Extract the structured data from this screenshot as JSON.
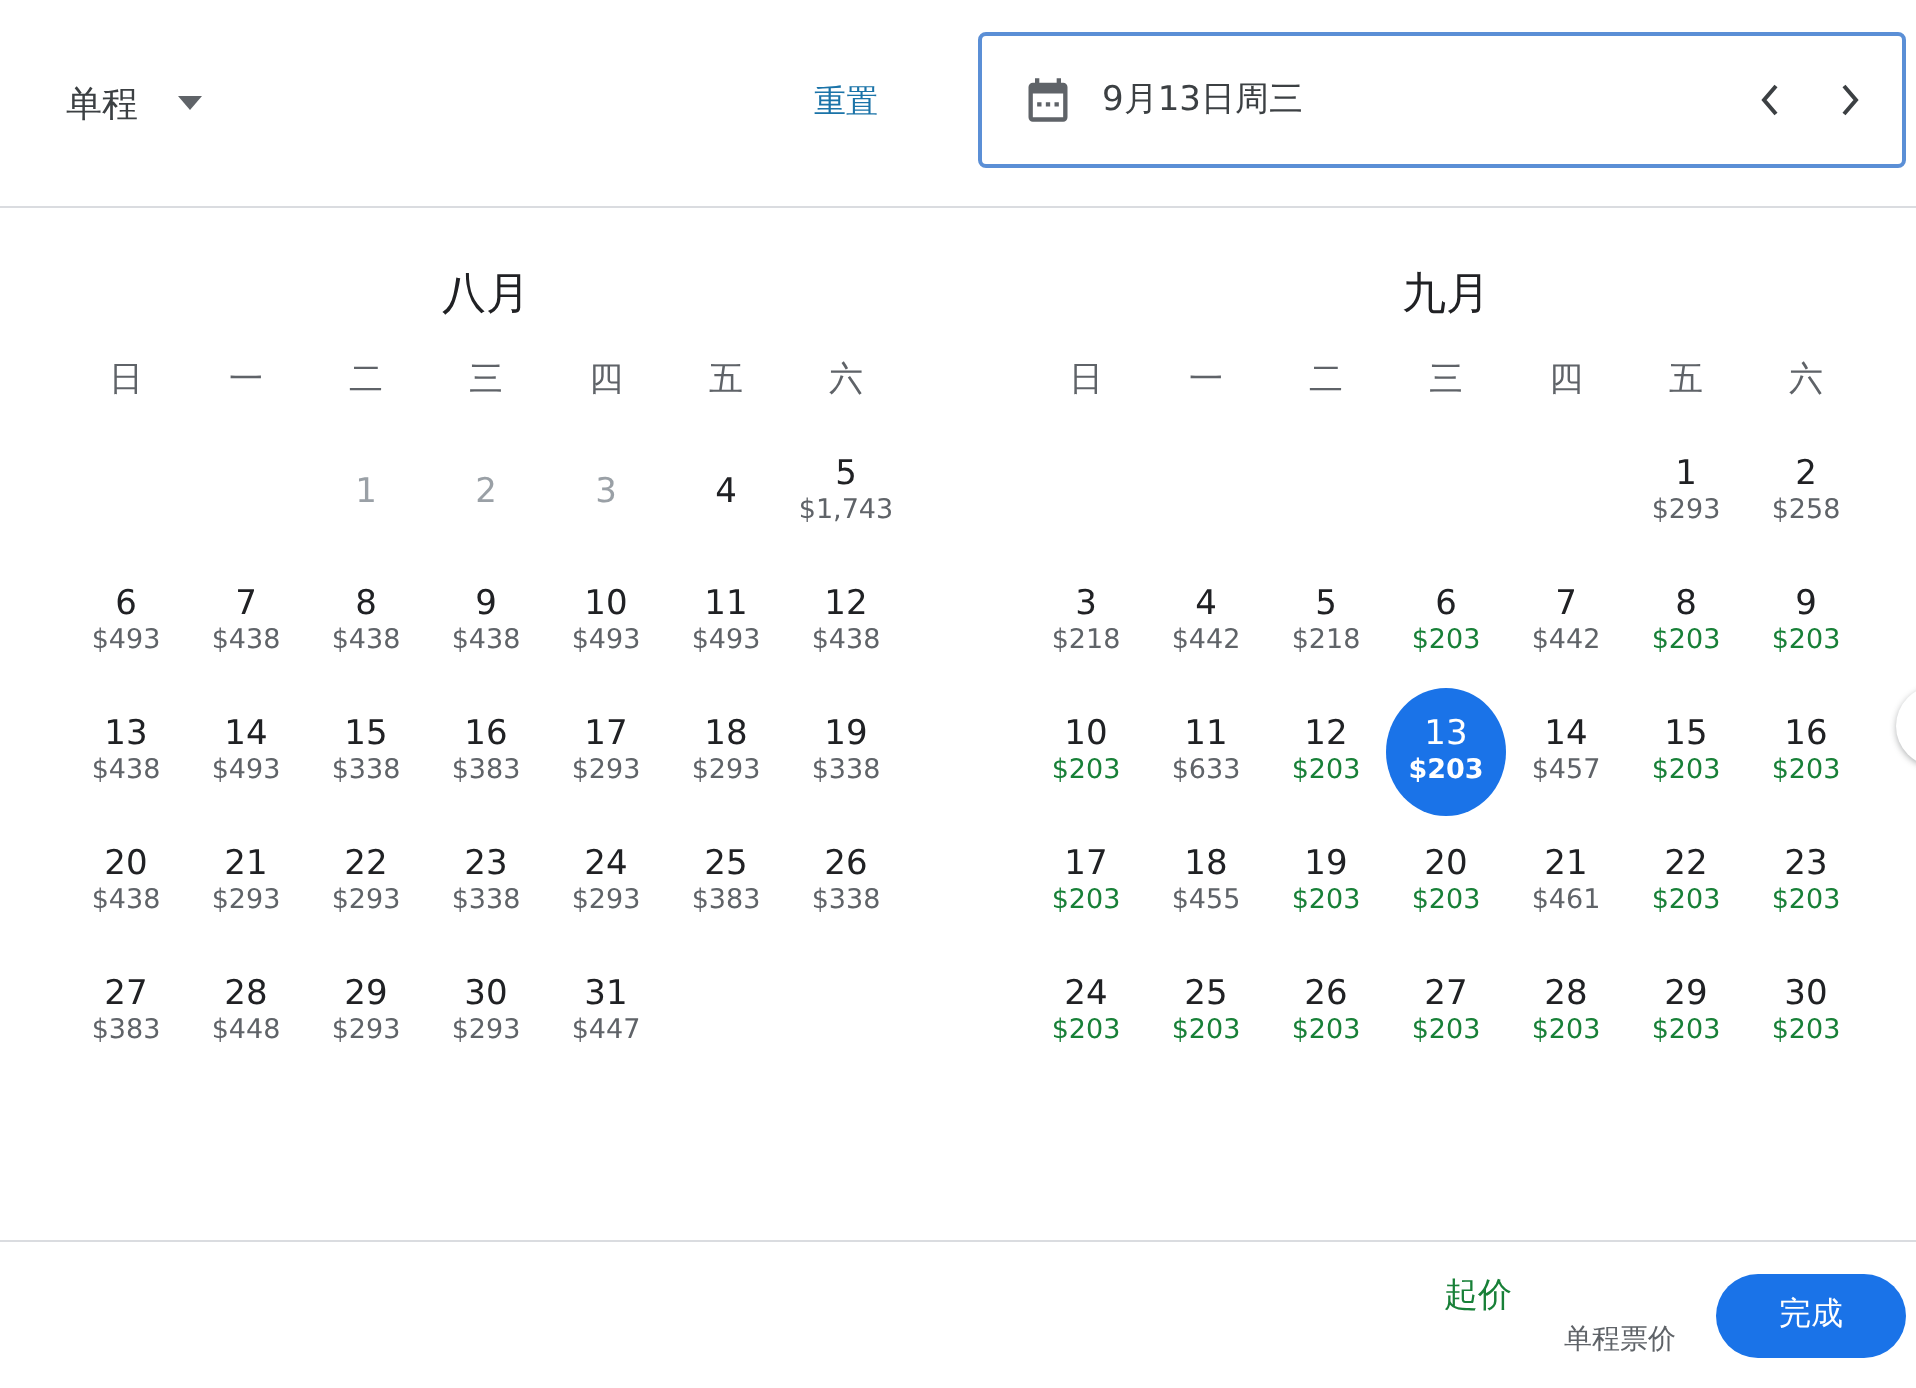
{
  "trip_type": {
    "label": "单程"
  },
  "reset_link": "重置",
  "date_field": {
    "value": "9月13日周三"
  },
  "months": [
    {
      "title": "八月",
      "weekdays": [
        "日",
        "一",
        "二",
        "三",
        "四",
        "五",
        "六"
      ],
      "days": [
        {
          "kind": "blank"
        },
        {
          "kind": "blank"
        },
        {
          "kind": "day",
          "number": "1",
          "disabled": true,
          "selected": false
        },
        {
          "kind": "day",
          "number": "2",
          "disabled": true,
          "selected": false
        },
        {
          "kind": "day",
          "number": "3",
          "disabled": true,
          "selected": false
        },
        {
          "kind": "day",
          "number": "4",
          "disabled": false,
          "selected": false
        },
        {
          "kind": "day",
          "number": "5",
          "price": "$1,743",
          "disabled": false,
          "low": false,
          "selected": false
        },
        {
          "kind": "day",
          "number": "6",
          "price": "$493",
          "disabled": false,
          "low": false,
          "selected": false
        },
        {
          "kind": "day",
          "number": "7",
          "price": "$438",
          "disabled": false,
          "low": false,
          "selected": false
        },
        {
          "kind": "day",
          "number": "8",
          "price": "$438",
          "disabled": false,
          "low": false,
          "selected": false
        },
        {
          "kind": "day",
          "number": "9",
          "price": "$438",
          "disabled": false,
          "low": false,
          "selected": false
        },
        {
          "kind": "day",
          "number": "10",
          "price": "$493",
          "disabled": false,
          "low": false,
          "selected": false
        },
        {
          "kind": "day",
          "number": "11",
          "price": "$493",
          "disabled": false,
          "low": false,
          "selected": false
        },
        {
          "kind": "day",
          "number": "12",
          "price": "$438",
          "disabled": false,
          "low": false,
          "selected": false
        },
        {
          "kind": "day",
          "number": "13",
          "price": "$438",
          "disabled": false,
          "low": false,
          "selected": false
        },
        {
          "kind": "day",
          "number": "14",
          "price": "$493",
          "disabled": false,
          "low": false,
          "selected": false
        },
        {
          "kind": "day",
          "number": "15",
          "price": "$338",
          "disabled": false,
          "low": false,
          "selected": false
        },
        {
          "kind": "day",
          "number": "16",
          "price": "$383",
          "disabled": false,
          "low": false,
          "selected": false
        },
        {
          "kind": "day",
          "number": "17",
          "price": "$293",
          "disabled": false,
          "low": false,
          "selected": false
        },
        {
          "kind": "day",
          "number": "18",
          "price": "$293",
          "disabled": false,
          "low": false,
          "selected": false
        },
        {
          "kind": "day",
          "number": "19",
          "price": "$338",
          "disabled": false,
          "low": false,
          "selected": false
        },
        {
          "kind": "day",
          "number": "20",
          "price": "$438",
          "disabled": false,
          "low": false,
          "selected": false
        },
        {
          "kind": "day",
          "number": "21",
          "price": "$293",
          "disabled": false,
          "low": false,
          "selected": false
        },
        {
          "kind": "day",
          "number": "22",
          "price": "$293",
          "disabled": false,
          "low": false,
          "selected": false
        },
        {
          "kind": "day",
          "number": "23",
          "price": "$338",
          "disabled": false,
          "low": false,
          "selected": false
        },
        {
          "kind": "day",
          "number": "24",
          "price": "$293",
          "disabled": false,
          "low": false,
          "selected": false
        },
        {
          "kind": "day",
          "number": "25",
          "price": "$383",
          "disabled": false,
          "low": false,
          "selected": false
        },
        {
          "kind": "day",
          "number": "26",
          "price": "$338",
          "disabled": false,
          "low": false,
          "selected": false
        },
        {
          "kind": "day",
          "number": "27",
          "price": "$383",
          "disabled": false,
          "low": false,
          "selected": false
        },
        {
          "kind": "day",
          "number": "28",
          "price": "$448",
          "disabled": false,
          "low": false,
          "selected": false
        },
        {
          "kind": "day",
          "number": "29",
          "price": "$293",
          "disabled": false,
          "low": false,
          "selected": false
        },
        {
          "kind": "day",
          "number": "30",
          "price": "$293",
          "disabled": false,
          "low": false,
          "selected": false
        },
        {
          "kind": "day",
          "number": "31",
          "price": "$447",
          "disabled": false,
          "low": false,
          "selected": false
        }
      ]
    },
    {
      "title": "九月",
      "weekdays": [
        "日",
        "一",
        "二",
        "三",
        "四",
        "五",
        "六"
      ],
      "days": [
        {
          "kind": "blank"
        },
        {
          "kind": "blank"
        },
        {
          "kind": "blank"
        },
        {
          "kind": "blank"
        },
        {
          "kind": "blank"
        },
        {
          "kind": "day",
          "number": "1",
          "price": "$293",
          "disabled": false,
          "low": false,
          "selected": false
        },
        {
          "kind": "day",
          "number": "2",
          "price": "$258",
          "disabled": false,
          "low": false,
          "selected": false
        },
        {
          "kind": "day",
          "number": "3",
          "price": "$218",
          "disabled": false,
          "low": false,
          "selected": false
        },
        {
          "kind": "day",
          "number": "4",
          "price": "$442",
          "disabled": false,
          "low": false,
          "selected": false
        },
        {
          "kind": "day",
          "number": "5",
          "price": "$218",
          "disabled": false,
          "low": false,
          "selected": false
        },
        {
          "kind": "day",
          "number": "6",
          "price": "$203",
          "disabled": false,
          "low": true,
          "selected": false
        },
        {
          "kind": "day",
          "number": "7",
          "price": "$442",
          "disabled": false,
          "low": false,
          "selected": false
        },
        {
          "kind": "day",
          "number": "8",
          "price": "$203",
          "disabled": false,
          "low": true,
          "selected": false
        },
        {
          "kind": "day",
          "number": "9",
          "price": "$203",
          "disabled": false,
          "low": true,
          "selected": false
        },
        {
          "kind": "day",
          "number": "10",
          "price": "$203",
          "disabled": false,
          "low": true,
          "selected": false
        },
        {
          "kind": "day",
          "number": "11",
          "price": "$633",
          "disabled": false,
          "low": false,
          "selected": false
        },
        {
          "kind": "day",
          "number": "12",
          "price": "$203",
          "disabled": false,
          "low": true,
          "selected": false
        },
        {
          "kind": "day",
          "number": "13",
          "price": "$203",
          "disabled": false,
          "low": true,
          "selected": true
        },
        {
          "kind": "day",
          "number": "14",
          "price": "$457",
          "disabled": false,
          "low": false,
          "selected": false
        },
        {
          "kind": "day",
          "number": "15",
          "price": "$203",
          "disabled": false,
          "low": true,
          "selected": false
        },
        {
          "kind": "day",
          "number": "16",
          "price": "$203",
          "disabled": false,
          "low": true,
          "selected": false
        },
        {
          "kind": "day",
          "number": "17",
          "price": "$203",
          "disabled": false,
          "low": true,
          "selected": false
        },
        {
          "kind": "day",
          "number": "18",
          "price": "$455",
          "disabled": false,
          "low": false,
          "selected": false
        },
        {
          "kind": "day",
          "number": "19",
          "price": "$203",
          "disabled": false,
          "low": true,
          "selected": false
        },
        {
          "kind": "day",
          "number": "20",
          "price": "$203",
          "disabled": false,
          "low": true,
          "selected": false
        },
        {
          "kind": "day",
          "number": "21",
          "price": "$461",
          "disabled": false,
          "low": false,
          "selected": false
        },
        {
          "kind": "day",
          "number": "22",
          "price": "$203",
          "disabled": false,
          "low": true,
          "selected": false
        },
        {
          "kind": "day",
          "number": "23",
          "price": "$203",
          "disabled": false,
          "low": true,
          "selected": false
        },
        {
          "kind": "day",
          "number": "24",
          "price": "$203",
          "disabled": false,
          "low": true,
          "selected": false
        },
        {
          "kind": "day",
          "number": "25",
          "price": "$203",
          "disabled": false,
          "low": true,
          "selected": false
        },
        {
          "kind": "day",
          "number": "26",
          "price": "$203",
          "disabled": false,
          "low": true,
          "selected": false
        },
        {
          "kind": "day",
          "number": "27",
          "price": "$203",
          "disabled": false,
          "low": true,
          "selected": false
        },
        {
          "kind": "day",
          "number": "28",
          "price": "$203",
          "disabled": false,
          "low": true,
          "selected": false
        },
        {
          "kind": "day",
          "number": "29",
          "price": "$203",
          "disabled": false,
          "low": true,
          "selected": false
        },
        {
          "kind": "day",
          "number": "30",
          "price": "$203",
          "disabled": false,
          "low": true,
          "selected": false
        }
      ]
    }
  ],
  "footer": {
    "price_label": "起价",
    "price_note": "单程票价",
    "done_button": "完成"
  }
}
